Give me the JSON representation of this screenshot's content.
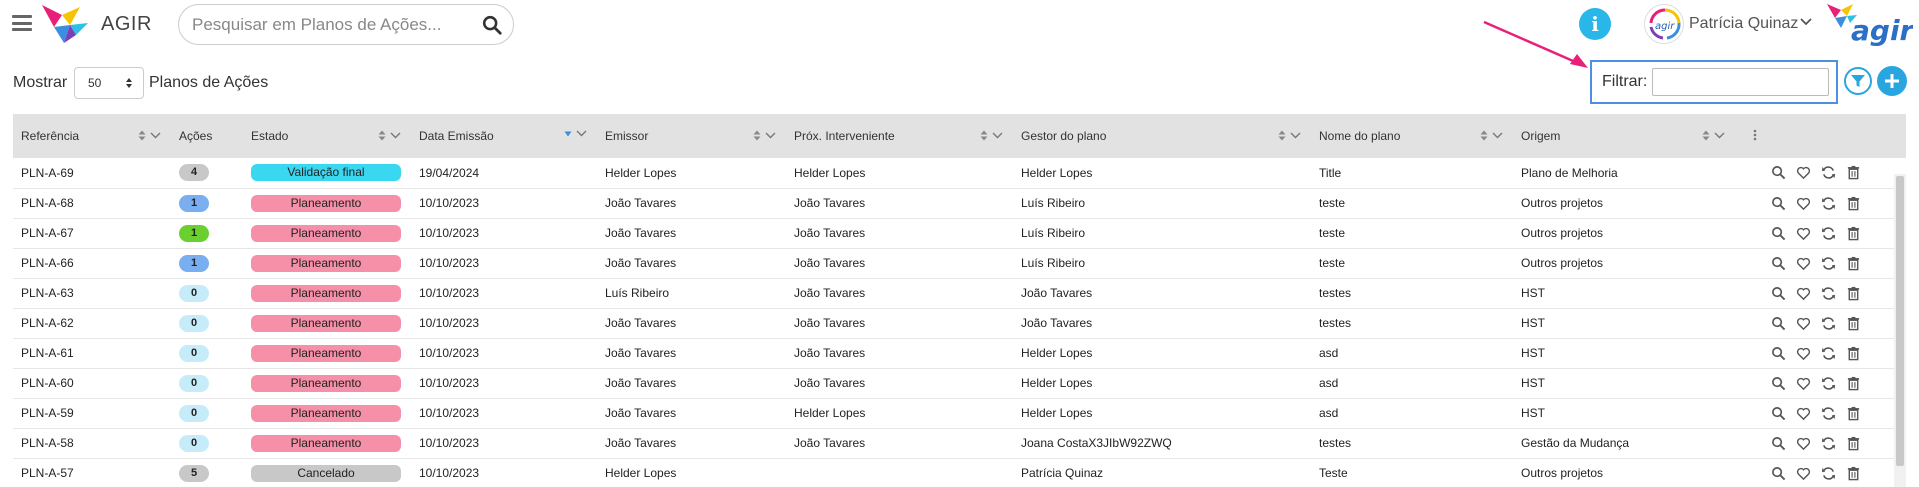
{
  "header": {
    "app_title": "AGIR",
    "search_placeholder": "Pesquisar em Planos de Ações...",
    "user_name": "Patrícia Quinaz"
  },
  "controls": {
    "show_label": "Mostrar",
    "show_value": "50",
    "show_suffix": "Planos de Ações",
    "filter_label": "Filtrar:",
    "filter_value": ""
  },
  "colors": {
    "accent": "#29a5e0",
    "annotation_arrow": "#e8207a",
    "filter_highlight": "#4d8fe0"
  },
  "table": {
    "columns": [
      "Referência",
      "Ações",
      "Estado",
      "Data Emissão",
      "Emissor",
      "Próx. Interveniente",
      "Gestor do plano",
      "Nome do plano",
      "Origem"
    ],
    "rows": [
      {
        "ref": "PLN-A-69",
        "acoes": "4",
        "acoes_color": "#c8c8c8",
        "estado": "Validação final",
        "estado_color": "#3ad7f0",
        "data": "19/04/2024",
        "emissor": "Helder Lopes",
        "prox": "Helder Lopes",
        "gestor": "Helder Lopes",
        "nome": "Title",
        "origem": "Plano de Melhoria"
      },
      {
        "ref": "PLN-A-68",
        "acoes": "1",
        "acoes_color": "#79aef0",
        "estado": "Planeamento",
        "estado_color": "#f590a8",
        "data": "10/10/2023",
        "emissor": "João Tavares",
        "prox": "João Tavares",
        "gestor": "Luís Ribeiro",
        "nome": "teste",
        "origem": "Outros projetos"
      },
      {
        "ref": "PLN-A-67",
        "acoes": "1",
        "acoes_color": "#6ad030",
        "estado": "Planeamento",
        "estado_color": "#f590a8",
        "data": "10/10/2023",
        "emissor": "João Tavares",
        "prox": "João Tavares",
        "gestor": "Luís Ribeiro",
        "nome": "teste",
        "origem": "Outros projetos"
      },
      {
        "ref": "PLN-A-66",
        "acoes": "1",
        "acoes_color": "#79aef0",
        "estado": "Planeamento",
        "estado_color": "#f590a8",
        "data": "10/10/2023",
        "emissor": "João Tavares",
        "prox": "João Tavares",
        "gestor": "Luís Ribeiro",
        "nome": "teste",
        "origem": "Outros projetos"
      },
      {
        "ref": "PLN-A-63",
        "acoes": "0",
        "acoes_color": "#c6ecfa",
        "estado": "Planeamento",
        "estado_color": "#f590a8",
        "data": "10/10/2023",
        "emissor": "Luís Ribeiro",
        "prox": "João Tavares",
        "gestor": "João Tavares",
        "nome": "testes",
        "origem": "HST"
      },
      {
        "ref": "PLN-A-62",
        "acoes": "0",
        "acoes_color": "#c6ecfa",
        "estado": "Planeamento",
        "estado_color": "#f590a8",
        "data": "10/10/2023",
        "emissor": "João Tavares",
        "prox": "João Tavares",
        "gestor": "João Tavares",
        "nome": "testes",
        "origem": "HST"
      },
      {
        "ref": "PLN-A-61",
        "acoes": "0",
        "acoes_color": "#c6ecfa",
        "estado": "Planeamento",
        "estado_color": "#f590a8",
        "data": "10/10/2023",
        "emissor": "João Tavares",
        "prox": "João Tavares",
        "gestor": "Helder Lopes",
        "nome": "asd",
        "origem": "HST"
      },
      {
        "ref": "PLN-A-60",
        "acoes": "0",
        "acoes_color": "#c6ecfa",
        "estado": "Planeamento",
        "estado_color": "#f590a8",
        "data": "10/10/2023",
        "emissor": "João Tavares",
        "prox": "João Tavares",
        "gestor": "Helder Lopes",
        "nome": "asd",
        "origem": "HST"
      },
      {
        "ref": "PLN-A-59",
        "acoes": "0",
        "acoes_color": "#c6ecfa",
        "estado": "Planeamento",
        "estado_color": "#f590a8",
        "data": "10/10/2023",
        "emissor": "João Tavares",
        "prox": "Helder Lopes",
        "gestor": "Helder Lopes",
        "nome": "asd",
        "origem": "HST"
      },
      {
        "ref": "PLN-A-58",
        "acoes": "0",
        "acoes_color": "#c6ecfa",
        "estado": "Planeamento",
        "estado_color": "#f590a8",
        "data": "10/10/2023",
        "emissor": "João Tavares",
        "prox": "João Tavares",
        "gestor": "Joana CostaX3JIbW92ZWQ",
        "nome": "testes",
        "origem": "Gestão da Mudança"
      },
      {
        "ref": "PLN-A-57",
        "acoes": "5",
        "acoes_color": "#c8c8c8",
        "estado": "Cancelado",
        "estado_color": "#c8c8c8",
        "data": "10/10/2023",
        "emissor": "Helder Lopes",
        "prox": "",
        "gestor": "Patrícia Quinaz",
        "nome": "Teste",
        "origem": "Outros projetos"
      }
    ]
  }
}
